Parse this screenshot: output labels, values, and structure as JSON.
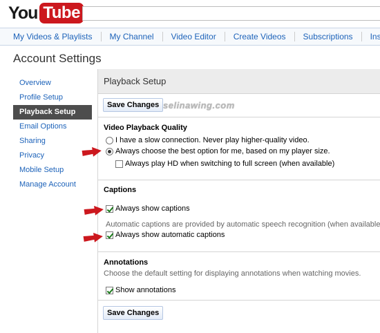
{
  "header": {
    "logo_you": "You",
    "logo_tube": "Tube",
    "search_value": ""
  },
  "nav": {
    "items": [
      "My Videos & Playlists",
      "My Channel",
      "Video Editor",
      "Create Videos",
      "Subscriptions",
      "Insight"
    ]
  },
  "page": {
    "title": "Account Settings"
  },
  "sidebar": {
    "items": [
      {
        "label": "Overview"
      },
      {
        "label": "Profile Setup"
      },
      {
        "label": "Playback Setup",
        "active": true
      },
      {
        "label": "Email Options"
      },
      {
        "label": "Sharing"
      },
      {
        "label": "Privacy"
      },
      {
        "label": "Mobile Setup"
      },
      {
        "label": "Manage Account"
      }
    ]
  },
  "panel": {
    "title": "Playback Setup",
    "save_label": "Save Changes",
    "watermark": "selinawing.com",
    "quality": {
      "title": "Video Playback Quality",
      "option_slow": "I have a slow connection. Never play higher-quality video.",
      "option_best": "Always choose the best option for me, based on my player size.",
      "option_hd": "Always play HD when switching to full screen (when available)",
      "selected": "option_best",
      "hd_checked": false
    },
    "captions": {
      "title": "Captions",
      "always_show": "Always show captions",
      "always_show_checked": true,
      "auto_note": "Automatic captions are provided by automatic speech recognition (when available).",
      "always_auto": "Always show automatic captions",
      "always_auto_checked": true
    },
    "annotations": {
      "title": "Annotations",
      "note": "Choose the default setting for displaying annotations when watching movies.",
      "show": "Show annotations",
      "show_checked": true
    }
  },
  "colors": {
    "accent_red": "#cc181e",
    "link_blue": "#1c62b9",
    "sidebar_active": "#4d4d4d"
  }
}
